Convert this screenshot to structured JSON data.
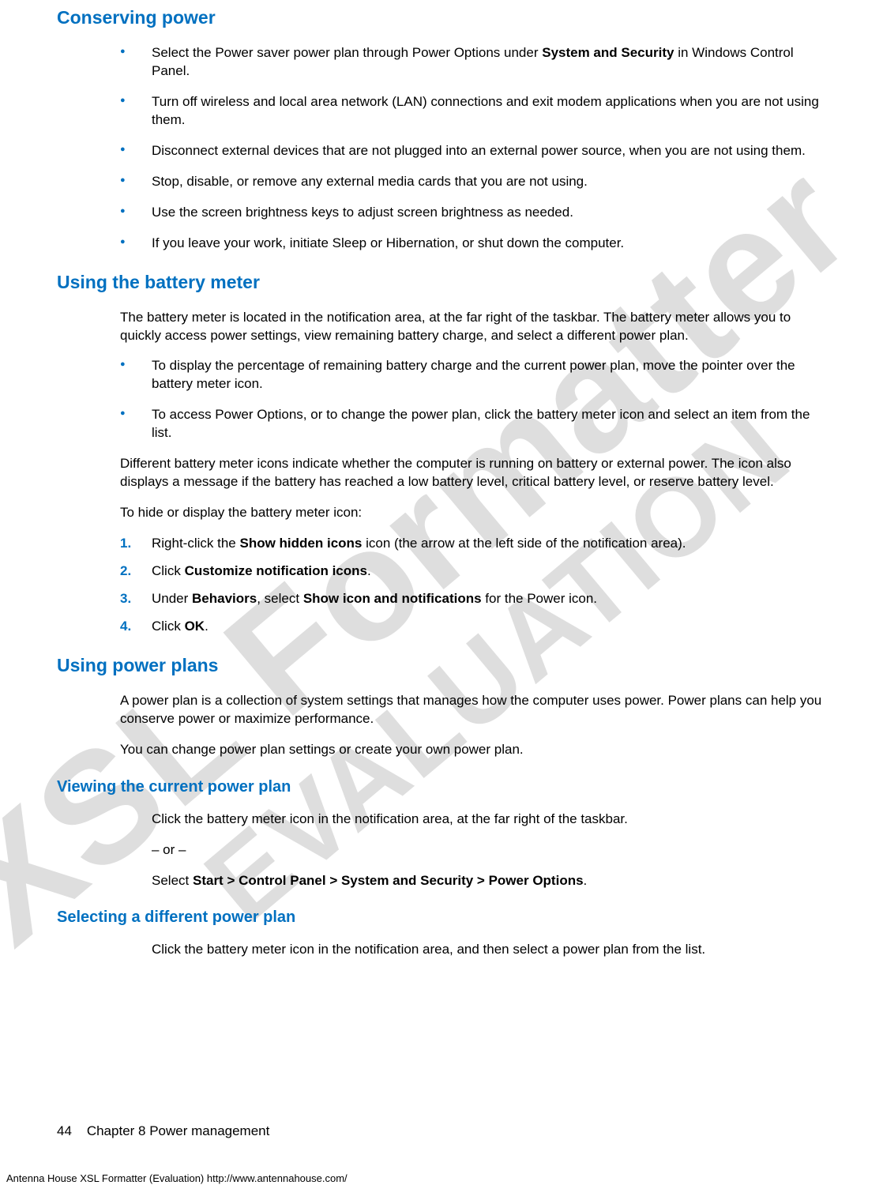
{
  "watermark": {
    "line1": "XSL Formatter",
    "line2": "EVALUATION"
  },
  "sections": {
    "conserving": {
      "title": "Conserving power",
      "bullets": [
        {
          "pre": "Select the Power saver power plan through Power Options under ",
          "bold": "System and Security",
          "post": " in Windows Control Panel."
        },
        {
          "text": "Turn off wireless and local area network (LAN) connections and exit modem applications when you are not using them."
        },
        {
          "text": "Disconnect external devices that are not plugged into an external power source, when you are not using them."
        },
        {
          "text": "Stop, disable, or remove any external media cards that you are not using."
        },
        {
          "text": "Use the screen brightness keys to adjust screen brightness as needed."
        },
        {
          "text": "If you leave your work, initiate Sleep or Hibernation, or shut down the computer."
        }
      ]
    },
    "battery_meter": {
      "title": "Using the battery meter",
      "intro": "The battery meter is located in the notification area, at the far right of the taskbar. The battery meter allows you to quickly access power settings, view remaining battery charge, and select a different power plan.",
      "bullets": [
        {
          "text": "To display the percentage of remaining battery charge and the current power plan, move the pointer over the battery meter icon."
        },
        {
          "text": "To access Power Options, or to change the power plan, click the battery meter icon and select an item from the list."
        }
      ],
      "para2": "Different battery meter icons indicate whether the computer is running on battery or external power. The icon also displays a message if the battery has reached a low battery level, critical battery level, or reserve battery level.",
      "para3": "To hide or display the battery meter icon:",
      "steps": [
        {
          "pre": "Right-click the ",
          "bold": "Show hidden icons",
          "post": " icon (the arrow at the left side of the notification area)."
        },
        {
          "pre": "Click ",
          "bold": "Customize notification icons",
          "post": "."
        },
        {
          "pre": "Under ",
          "bold": "Behaviors",
          "mid": ", select ",
          "bold2": "Show icon and notifications",
          "post": " for the Power icon."
        },
        {
          "pre": "Click ",
          "bold": "OK",
          "post": "."
        }
      ]
    },
    "power_plans": {
      "title": "Using power plans",
      "intro": "A power plan is a collection of system settings that manages how the computer uses power. Power plans can help you conserve power or maximize performance.",
      "para2": "You can change power plan settings or create your own power plan."
    },
    "viewing": {
      "title": "Viewing the current power plan",
      "p1": "Click the battery meter icon in the notification area, at the far right of the taskbar.",
      "or": "– or –",
      "p2_pre": "Select ",
      "p2_bold": "Start > Control Panel > System and Security > Power Options",
      "p2_post": "."
    },
    "selecting": {
      "title": "Selecting a different power plan",
      "p1": "Click the battery meter icon in the notification area, and then select a power plan from the list."
    }
  },
  "footer": {
    "page_number": "44",
    "chapter": "Chapter 8   Power management",
    "eval": "Antenna House XSL Formatter (Evaluation)  http://www.antennahouse.com/"
  }
}
